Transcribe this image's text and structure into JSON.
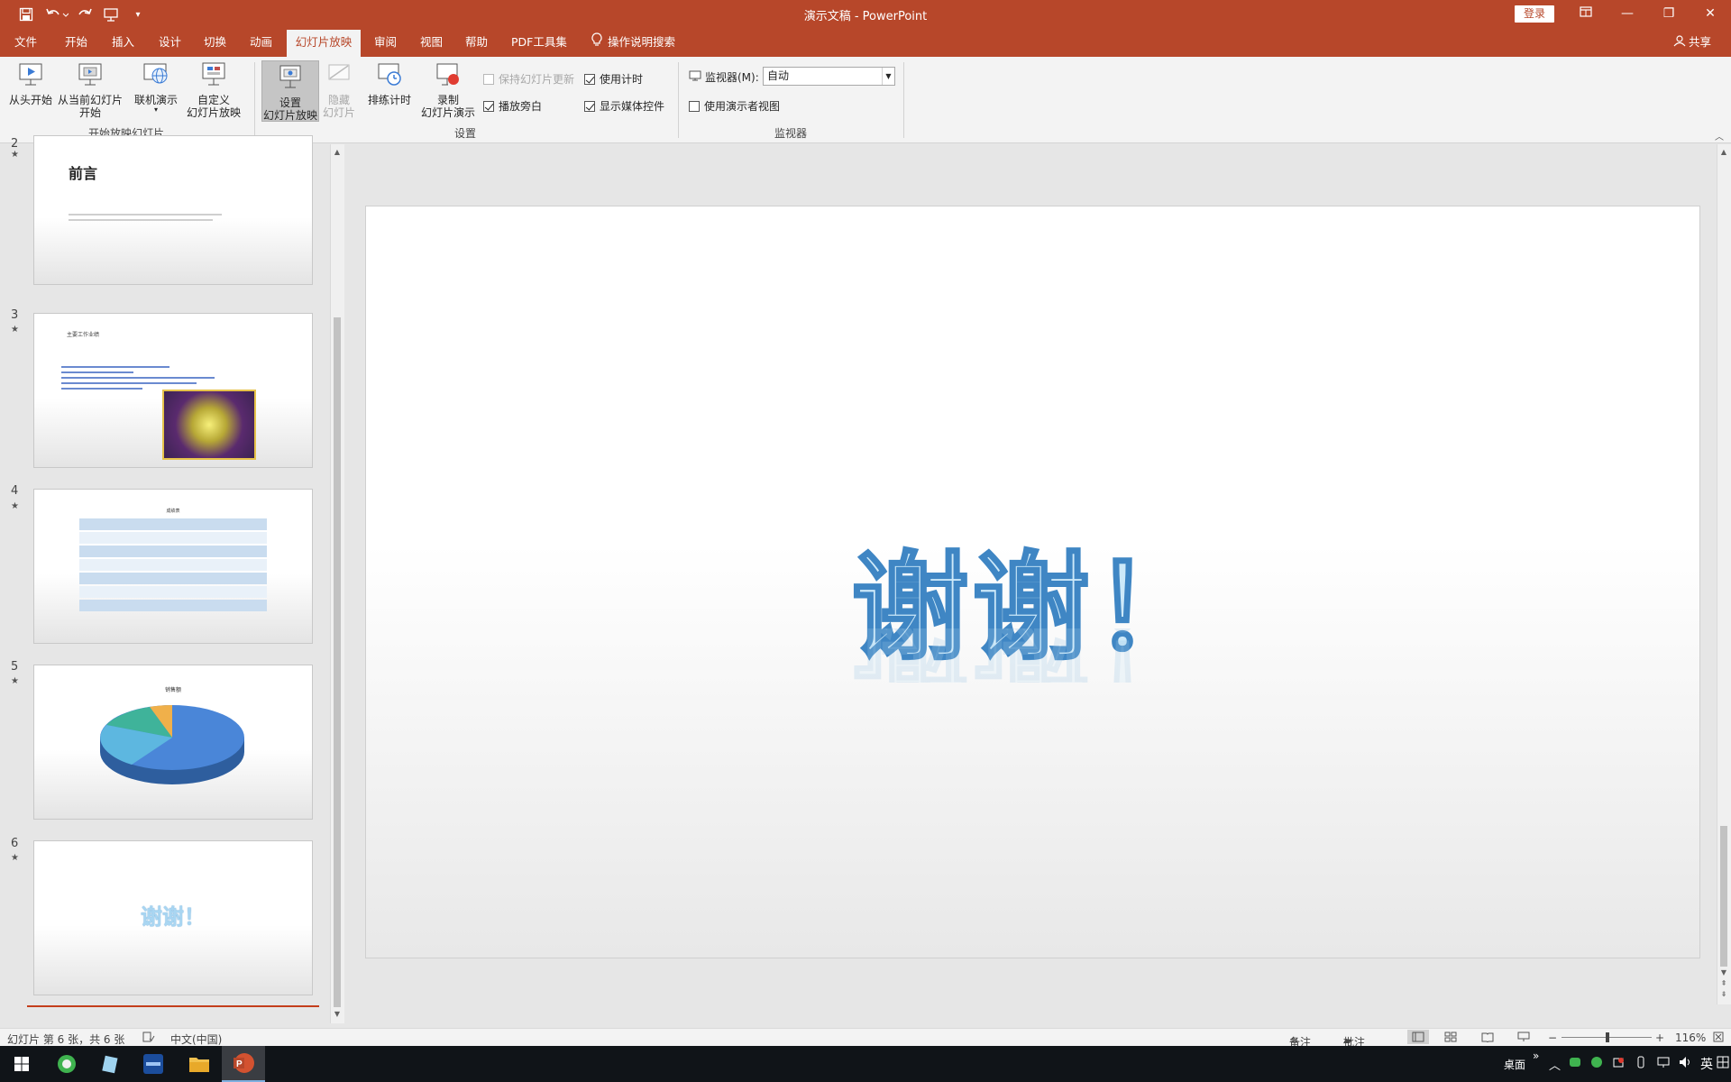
{
  "app": {
    "window_title": "演示文稿 - PowerPoint",
    "sign_in": "登录",
    "share": "共享"
  },
  "qat": {
    "save_icon": "save-icon",
    "undo_icon": "undo-icon",
    "redo_icon": "redo-icon",
    "present_icon": "start-from-beginning-icon",
    "customize_icon": "customize-qat-icon"
  },
  "window_controls": {
    "ribbon_display_icon": "ribbon-display-options-icon",
    "minimize": "—",
    "restore": "❐",
    "close": "✕"
  },
  "tabs": [
    {
      "label": "文件",
      "active": false
    },
    {
      "label": "开始",
      "active": false
    },
    {
      "label": "插入",
      "active": false
    },
    {
      "label": "设计",
      "active": false
    },
    {
      "label": "切换",
      "active": false
    },
    {
      "label": "动画",
      "active": false
    },
    {
      "label": "幻灯片放映",
      "active": true
    },
    {
      "label": "审阅",
      "active": false
    },
    {
      "label": "视图",
      "active": false
    },
    {
      "label": "帮助",
      "active": false
    },
    {
      "label": "PDF工具集",
      "active": false
    },
    {
      "label": "操作说明搜索",
      "active": false
    }
  ],
  "ribbon": {
    "group_start": {
      "label": "开始放映幻灯片",
      "from_beginning": "从头开始",
      "from_current_l1": "从当前幻灯片",
      "from_current_l2": "开始",
      "online_present": "联机演示",
      "custom_show_l1": "自定义",
      "custom_show_l2": "幻灯片放映"
    },
    "group_setup": {
      "label": "设置",
      "setup_show_l1": "设置",
      "setup_show_l2": "幻灯片放映",
      "hide_slide_l1": "隐藏",
      "hide_slide_l2": "幻灯片",
      "rehearse": "排练计时",
      "record_l1": "录制",
      "record_l2": "幻灯片演示",
      "keep_updated": "保持幻灯片更新",
      "keep_updated_checked": false,
      "play_narrations": "播放旁白",
      "play_narrations_checked": true,
      "use_timings": "使用计时",
      "use_timings_checked": true,
      "show_media_controls": "显示媒体控件",
      "show_media_controls_checked": true
    },
    "group_monitors": {
      "label": "监视器",
      "monitor_label": "监视器(M):",
      "monitor_value": "自动",
      "presenter_view": "使用演示者视图",
      "presenter_view_checked": false
    }
  },
  "thumbnails": [
    {
      "number": "2",
      "title": "前言"
    },
    {
      "number": "3",
      "title": "主要工作业绩"
    },
    {
      "number": "4",
      "title": "成绩表"
    },
    {
      "number": "5",
      "title": "销售额"
    },
    {
      "number": "6",
      "title": "谢谢！"
    }
  ],
  "main_slide": {
    "text": "谢谢！"
  },
  "status": {
    "slide_info": "幻灯片 第 6 张，共 6 张",
    "language": "中文(中国)",
    "notes": "备注",
    "comments": "批注",
    "zoom": "116%",
    "zoom_minus": "−",
    "zoom_plus": "+"
  },
  "taskbar": {
    "desktop_label": "桌面",
    "ime": "英",
    "show_more": "»",
    "apps": [
      "start-icon",
      "browser-icon",
      "notepad-icon",
      "media-app-icon",
      "file-explorer-icon",
      "powerpoint-icon"
    ]
  },
  "colors": {
    "accent": "#b7472a",
    "ribbon_bg": "#f3f3f3",
    "workspace_bg": "#e6e6e6",
    "slide_text": "#9fd0ee"
  }
}
